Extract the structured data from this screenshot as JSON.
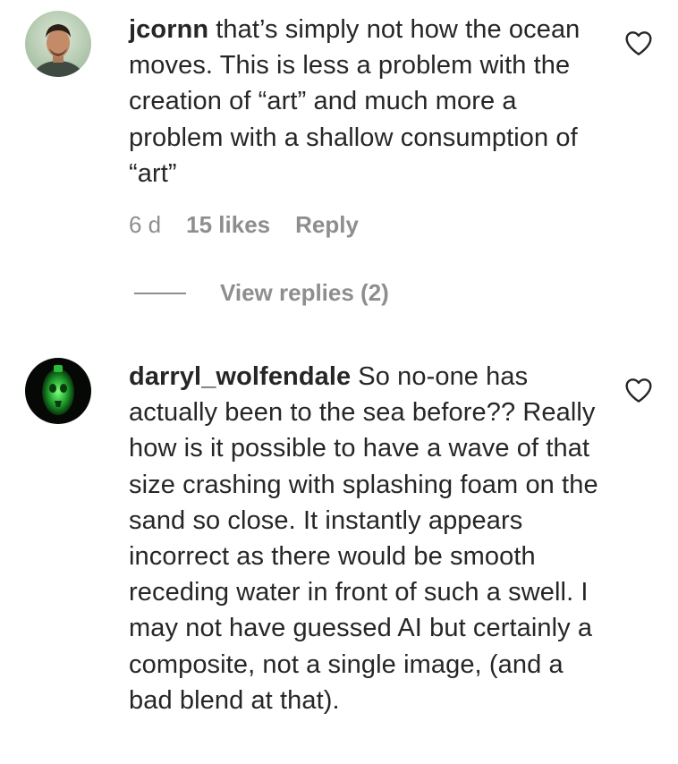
{
  "comments": [
    {
      "username": "jcornn",
      "text": "that’s simply not how the ocean moves. This is less a problem with the creation of “art” and much more a problem with a shallow consumption of “art”",
      "time": "6 d",
      "likes": "15 likes",
      "reply_label": "Reply",
      "view_replies": "View replies (2)",
      "avatar_icon": "person-photo-avatar"
    },
    {
      "username": "darryl_wolfendale",
      "text": "So no-one has actually been to the sea before?? Really how is it possible to have a wave of that size crashing with splashing foam on the sand so close. It instantly appears incorrect as there would be smooth receding water in front of such a swell. I may not have guessed AI but certainly a composite, not a single image, (and a bad blend at that).",
      "avatar_icon": "green-skull-avatar"
    }
  ],
  "icons": {
    "like": "heart-outline-icon"
  },
  "colors": {
    "text": "#262626",
    "secondary": "#8e8e8e",
    "background": "#ffffff"
  }
}
